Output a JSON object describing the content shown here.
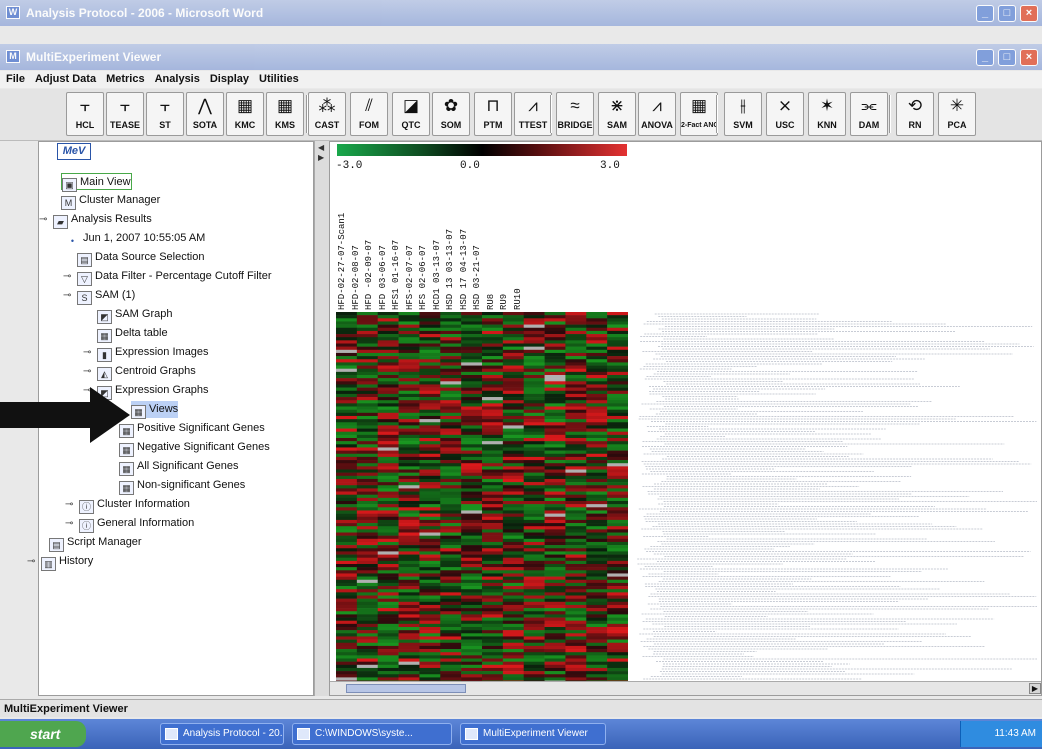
{
  "word_window": {
    "title": "Analysis Protocol - 2006 - Microsoft Word",
    "icon": "word-icon"
  },
  "app_window": {
    "title": "MultiExperiment Viewer",
    "icon": "mev-icon"
  },
  "menu": [
    "File",
    "Adjust Data",
    "Metrics",
    "Analysis",
    "Display",
    "Utilities"
  ],
  "toolbar": [
    {
      "label": "HCL",
      "icon": "tree-icon"
    },
    {
      "label": "TEASE",
      "icon": "tree-icon"
    },
    {
      "label": "ST",
      "icon": "tree-icon"
    },
    {
      "label": "SOTA",
      "icon": "network-icon"
    },
    {
      "label": "KMC",
      "icon": "cluster-icon"
    },
    {
      "label": "KMS",
      "icon": "cluster-icon"
    },
    {
      "label": "CAST",
      "icon": "scatter-icon"
    },
    {
      "label": "FOM",
      "icon": "graph-icon"
    },
    {
      "label": "QTC",
      "icon": "qtc-icon"
    },
    {
      "label": "SOM",
      "icon": "som-icon"
    },
    {
      "label": "PTM",
      "icon": "ptm-icon"
    },
    {
      "label": "TTEST",
      "icon": "ttest-icon"
    },
    {
      "label": "BRIDGE",
      "icon": "bridge-icon"
    },
    {
      "label": "SAM",
      "icon": "sam-icon"
    },
    {
      "label": "ANOVA",
      "icon": "anova-icon"
    },
    {
      "label": "2-Fact ANOVA",
      "icon": "grid-icon"
    },
    {
      "label": "SVM",
      "icon": "svm-icon"
    },
    {
      "label": "USC",
      "icon": "usc-icon"
    },
    {
      "label": "KNN",
      "icon": "knn-icon"
    },
    {
      "label": "DAM",
      "icon": "dam-icon"
    },
    {
      "label": "RN",
      "icon": "rn-icon"
    },
    {
      "label": "PCA",
      "icon": "pca-icon"
    }
  ],
  "tree": {
    "root_label": "MeV",
    "items": [
      {
        "label": "Main View",
        "icon": "main-view-icon",
        "selected": false
      },
      {
        "label": "Cluster Manager",
        "icon": "cluster-manager-icon"
      },
      {
        "label": "Analysis Results",
        "icon": "folder-icon"
      },
      {
        "label": "Jun 1, 2007 10:55:05 AM",
        "icon": "bullet-icon"
      },
      {
        "label": "Data Source Selection",
        "icon": "data-source-icon"
      },
      {
        "label": "Data Filter - Percentage Cutoff Filter",
        "icon": "filter-icon"
      },
      {
        "label": "SAM (1)",
        "icon": "sam-node-icon"
      },
      {
        "label": "SAM Graph",
        "icon": "graph-icon"
      },
      {
        "label": "Delta table",
        "icon": "table-icon"
      },
      {
        "label": "Expression Images",
        "icon": "image-icon"
      },
      {
        "label": "Centroid Graphs",
        "icon": "centroid-icon"
      },
      {
        "label": "Expression Graphs",
        "icon": "graph-icon"
      },
      {
        "label": "Views",
        "icon": "table-icon",
        "selected": true
      },
      {
        "label": "Positive Significant Genes",
        "icon": "table-icon"
      },
      {
        "label": "Negative Significant Genes",
        "icon": "table-icon"
      },
      {
        "label": "All Significant Genes",
        "icon": "table-icon"
      },
      {
        "label": "Non-significant Genes",
        "icon": "table-icon"
      },
      {
        "label": "Cluster Information",
        "icon": "info-icon"
      },
      {
        "label": "General Information",
        "icon": "info-icon"
      },
      {
        "label": "Script Manager",
        "icon": "script-icon"
      },
      {
        "label": "History",
        "icon": "history-icon"
      }
    ]
  },
  "scale": {
    "min": "-3.0",
    "mid": "0.0",
    "max": "3.0",
    "colors": [
      "#19a84b",
      "#000000",
      "#e43232"
    ]
  },
  "samples": [
    "HFD-02-27-07-Scan1",
    "HFD-02-08-07",
    "HFD -02-09-07",
    "HFD 03-06-07",
    "HFS1 01-16-07",
    "HFS-02-07-07",
    "HFS 02-06-07",
    "HCD1 03-13-07",
    "HSD 13 03-13-07",
    "HSD 17 04-13-07",
    "HSD 03-21-07",
    "RU8",
    "RU9",
    "RU10"
  ],
  "status_bar": {
    "text": "MultiExperiment Viewer"
  },
  "taskbar": {
    "start": "start",
    "tasks": [
      {
        "label": "Analysis Protocol - 20...",
        "icon": "word-icon"
      },
      {
        "label": "C:\\WINDOWS\\syste...",
        "icon": "console-icon"
      },
      {
        "label": "MultiExperiment Viewer",
        "icon": "mev-icon"
      }
    ],
    "clock": "11:43 AM"
  }
}
